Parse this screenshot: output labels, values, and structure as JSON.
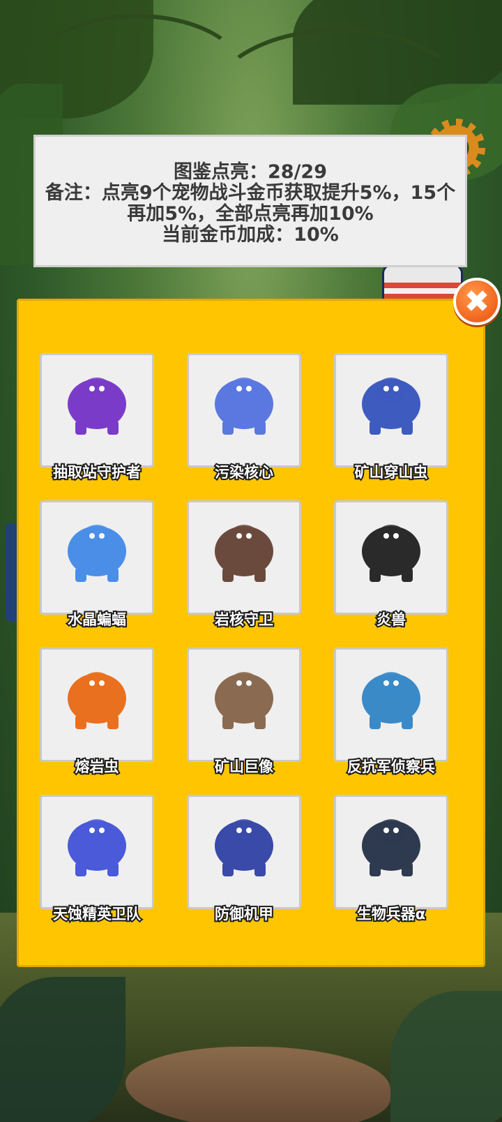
{
  "info_panel": {
    "progress_line": "图鉴点亮：28/29",
    "note_line": "备注：点亮9个宠物战斗金币获取提升5%，15个再加5%，全部点亮再加10%",
    "bonus_line": "当前金币加成：10%"
  },
  "close_button": {
    "label": "✖",
    "icon": "close-icon"
  },
  "pets": [
    {
      "name": "抽取站守护者",
      "icon": "extraction-guardian-icon",
      "color": "#7a3cc8"
    },
    {
      "name": "污染核心",
      "icon": "polluted-core-robot-icon",
      "color": "#5a78e0"
    },
    {
      "name": "矿山穿山虫",
      "icon": "mine-worm-icon",
      "color": "#3e5bc0"
    },
    {
      "name": "水晶蝙蝠",
      "icon": "crystal-bat-icon",
      "color": "#4a8ee8"
    },
    {
      "name": "岩核守卫",
      "icon": "rock-golem-icon",
      "color": "#6b4a3e"
    },
    {
      "name": "炎兽",
      "icon": "flame-beast-icon",
      "color": "#2a2a2a"
    },
    {
      "name": "熔岩虫",
      "icon": "lava-worm-icon",
      "color": "#e8701e"
    },
    {
      "name": "矿山巨像",
      "icon": "mine-colossus-icon",
      "color": "#8a6a50"
    },
    {
      "name": "反抗军侦察兵",
      "icon": "rebel-scout-icon",
      "color": "#3a8ac8"
    },
    {
      "name": "天蚀精英卫队",
      "icon": "eclipse-elite-guard-icon",
      "color": "#4a5ad8"
    },
    {
      "name": "防御机甲",
      "icon": "defense-mech-icon",
      "color": "#3a4aa8"
    },
    {
      "name": "生物兵器α",
      "icon": "bio-weapon-alpha-icon",
      "color": "#2e3a50"
    }
  ]
}
